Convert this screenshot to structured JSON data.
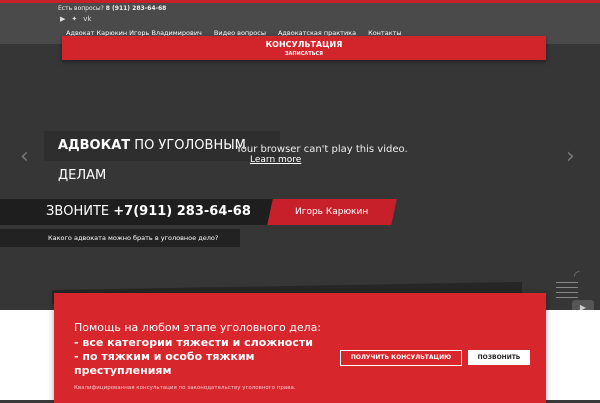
{
  "topbar": {
    "question_label": "Есть вопросы?",
    "phone": "8 (911) 283-64-68",
    "social": [
      "youtube-icon",
      "twitter-icon",
      "vk-icon"
    ]
  },
  "nav": {
    "items": [
      "Адвокат Карюкин Игорь Владимирович",
      "Видео вопросы",
      "Адвокатская практика",
      "Контакты"
    ]
  },
  "consult": {
    "title": "КОНСУЛЬТАЦИЯ",
    "subtitle": "ЗАПИСАТЬСЯ"
  },
  "hero": {
    "headline_bold": "АДВОКАТ",
    "headline_rest": " ПО УГОЛОВНЫМ ДЕЛАМ",
    "video_error": "Your browser can't play this video.",
    "video_link": "Learn more",
    "call_label": "ЗВОНИТЕ",
    "call_phone": "+7(911) 283-64-68",
    "name_button": "Игорь Карюкин",
    "question": "Какого адвоката можно брать в уголовное дело?"
  },
  "panel": {
    "title": "Помощь на любом этапе уголовного дела:",
    "lines": [
      "- все категории тяжести и сложности",
      "- по тяжким и особо тяжким",
      "преступлениям"
    ],
    "small": "Квалифицированная консультация по законодательству уголовного права.",
    "btn_consult": "ПОЛУЧИТЬ КОНСУЛЬТАЦИЮ",
    "btn_call": "ПОЗВОНИТЬ"
  },
  "colors": {
    "accent": "#d1242b",
    "dark": "#363636"
  }
}
